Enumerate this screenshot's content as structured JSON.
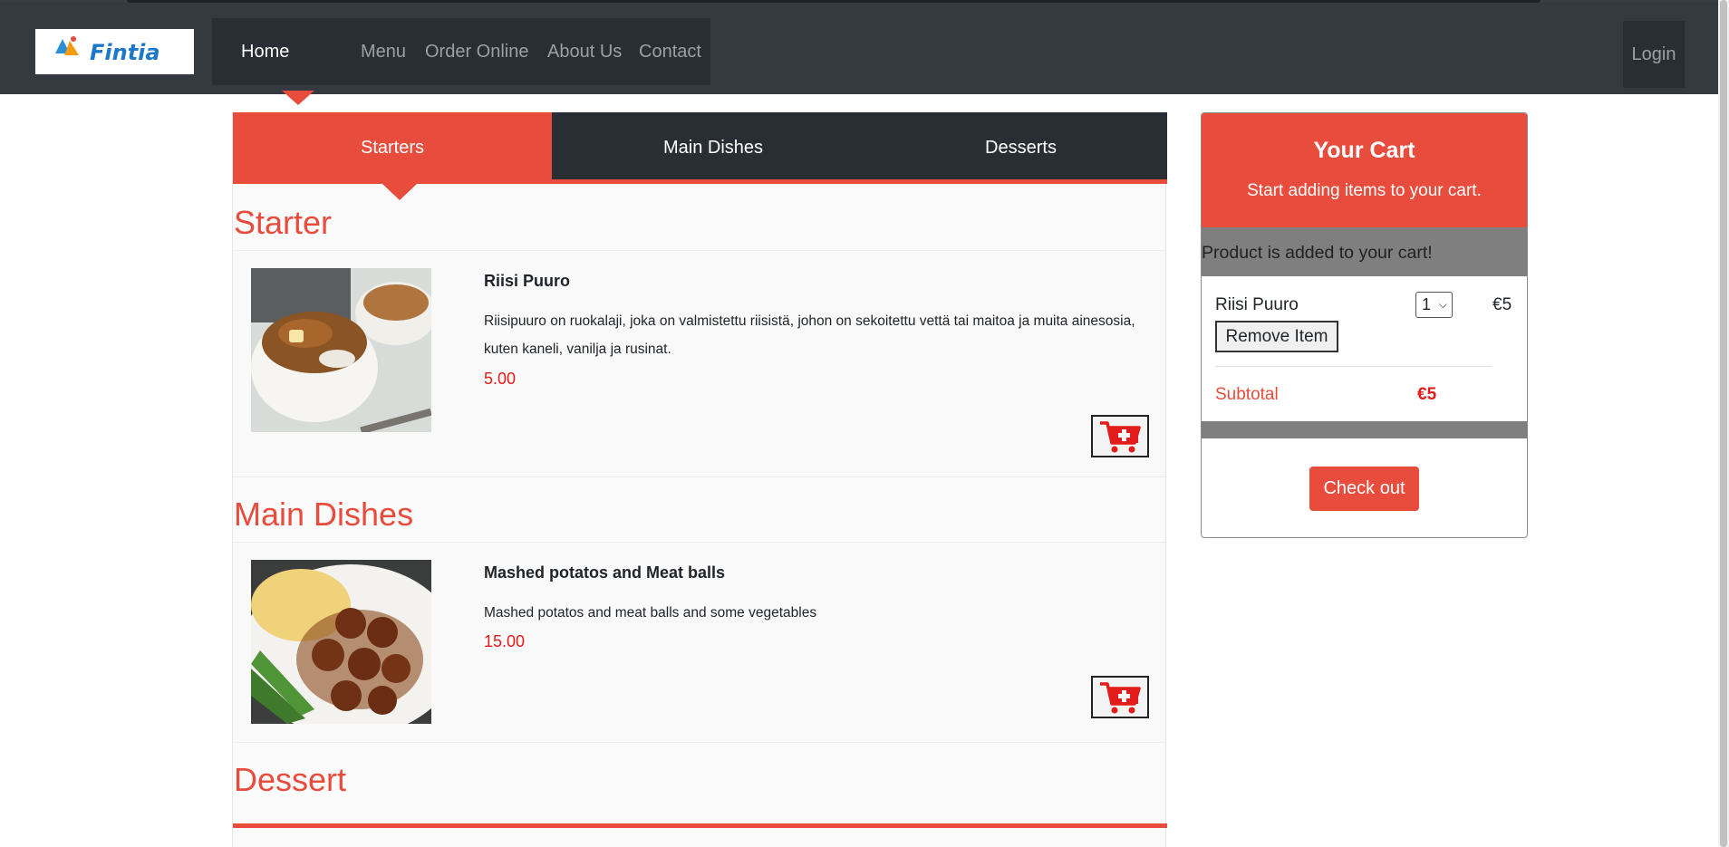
{
  "nav": {
    "logo_text": "Fintia",
    "links": [
      "Home",
      "Menu",
      "Order Online",
      "About Us",
      "Contact"
    ],
    "login": "Login"
  },
  "tabs": [
    "Starters",
    "Main Dishes",
    "Desserts"
  ],
  "sections": {
    "starter_title": "Starter",
    "main_title": "Main Dishes",
    "dessert_title": "Dessert"
  },
  "items": [
    {
      "name": "Riisi Puuro",
      "description": "Riisipuuro on ruokalaji, joka on valmistettu riisistä, johon on sekoitettu vettä tai maitoa ja muita ainesosia, kuten kaneli, vanilja ja rusinat.",
      "price": "5.00",
      "icon": "add-to-cart-icon"
    },
    {
      "name": "Mashed potatos and Meat balls",
      "description": "Mashed potatos and meat balls and some vegetables",
      "price": "15.00",
      "icon": "add-to-cart-icon"
    }
  ],
  "cart": {
    "title": "Your Cart",
    "subtitle": "Start adding items to your cart.",
    "message": "Product is added to your cart!",
    "line_item": {
      "name": "Riisi Puuro",
      "qty": "1",
      "price": "€5",
      "remove_label": "Remove Item"
    },
    "subtotal_label": "Subtotal",
    "subtotal_value": "€5",
    "checkout_label": "Check out"
  },
  "colors": {
    "accent": "#e74c3c",
    "navbar": "#343a40",
    "nav_dark": "#292e34",
    "price": "#e41b1b"
  }
}
